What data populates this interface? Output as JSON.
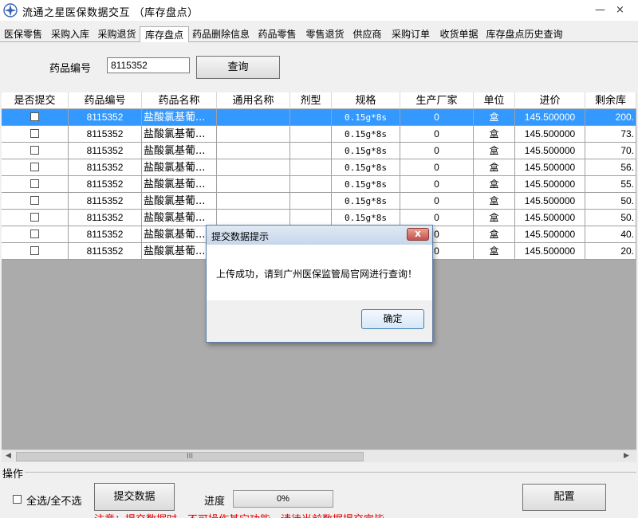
{
  "window": {
    "title": "流通之星医保数据交互  （库存盘点）",
    "minimize": "—",
    "close": "×"
  },
  "tabs": [
    "医保零售",
    "采购入库",
    "采购退货",
    "库存盘点",
    "药品删除信息",
    "药品零售",
    "零售退货",
    "供应商",
    "采购订单",
    "收货单据",
    "库存盘点历史查询"
  ],
  "active_tab": "库存盘点",
  "search": {
    "label": "药品编号",
    "value": "8115352",
    "button": "查询"
  },
  "grid": {
    "columns": [
      "是否提交",
      "药品编号",
      "药品名称",
      "通用名称",
      "剂型",
      "规格",
      "生产厂家",
      "单位",
      "进价",
      "剩余库"
    ],
    "rows": [
      {
        "code": "8115352",
        "name": "盐酸氯基葡...",
        "generic": "",
        "form": "",
        "spec": "0.15g*8s",
        "maker": "0",
        "unit": "盒",
        "price": "145.500000",
        "stock": "200.",
        "selected": true
      },
      {
        "code": "8115352",
        "name": "盐酸氯基葡...",
        "generic": "",
        "form": "",
        "spec": "0.15g*8s",
        "maker": "0",
        "unit": "盒",
        "price": "145.500000",
        "stock": "73.",
        "selected": false
      },
      {
        "code": "8115352",
        "name": "盐酸氯基葡...",
        "generic": "",
        "form": "",
        "spec": "0.15g*8s",
        "maker": "0",
        "unit": "盒",
        "price": "145.500000",
        "stock": "70.",
        "selected": false
      },
      {
        "code": "8115352",
        "name": "盐酸氯基葡...",
        "generic": "",
        "form": "",
        "spec": "0.15g*8s",
        "maker": "0",
        "unit": "盒",
        "price": "145.500000",
        "stock": "56.",
        "selected": false
      },
      {
        "code": "8115352",
        "name": "盐酸氯基葡...",
        "generic": "",
        "form": "",
        "spec": "0.15g*8s",
        "maker": "0",
        "unit": "盒",
        "price": "145.500000",
        "stock": "55.",
        "selected": false
      },
      {
        "code": "8115352",
        "name": "盐酸氯基葡...",
        "generic": "",
        "form": "",
        "spec": "0.15g*8s",
        "maker": "0",
        "unit": "盒",
        "price": "145.500000",
        "stock": "50.",
        "selected": false
      },
      {
        "code": "8115352",
        "name": "盐酸氯基葡...",
        "generic": "",
        "form": "",
        "spec": "0.15g*8s",
        "maker": "0",
        "unit": "盒",
        "price": "145.500000",
        "stock": "50.",
        "selected": false
      },
      {
        "code": "8115352",
        "name": "盐酸氯基葡...",
        "generic": "",
        "form": "",
        "spec": "0.15g*8s",
        "maker": "0",
        "unit": "盒",
        "price": "145.500000",
        "stock": "40.",
        "selected": false
      },
      {
        "code": "8115352",
        "name": "盐酸氯基葡...",
        "generic": "",
        "form": "",
        "spec": "0.15g*8s",
        "maker": "0",
        "unit": "盒",
        "price": "145.500000",
        "stock": "20.",
        "selected": false
      }
    ],
    "scroll_thumb": "III",
    "scroll_left": "◀",
    "scroll_right": "▶"
  },
  "operations": {
    "group_title": "操作",
    "select_all": "全选/全不选",
    "submit_button": "提交数据",
    "progress_label": "进度",
    "progress": {
      "value": 0,
      "text": "0%"
    },
    "config_button": "配置",
    "notice": "注意：提交数据时，不可操作其它功能，请待当前数据提交完毕"
  },
  "dialog": {
    "title": "提交数据提示",
    "close": "x",
    "message": "上传成功，请到广州医保监管局官网进行查询！",
    "ok": "确定"
  },
  "colors": {
    "selection": "#3399ff",
    "notice": "#e00000",
    "dialog_close": "#c75050"
  }
}
